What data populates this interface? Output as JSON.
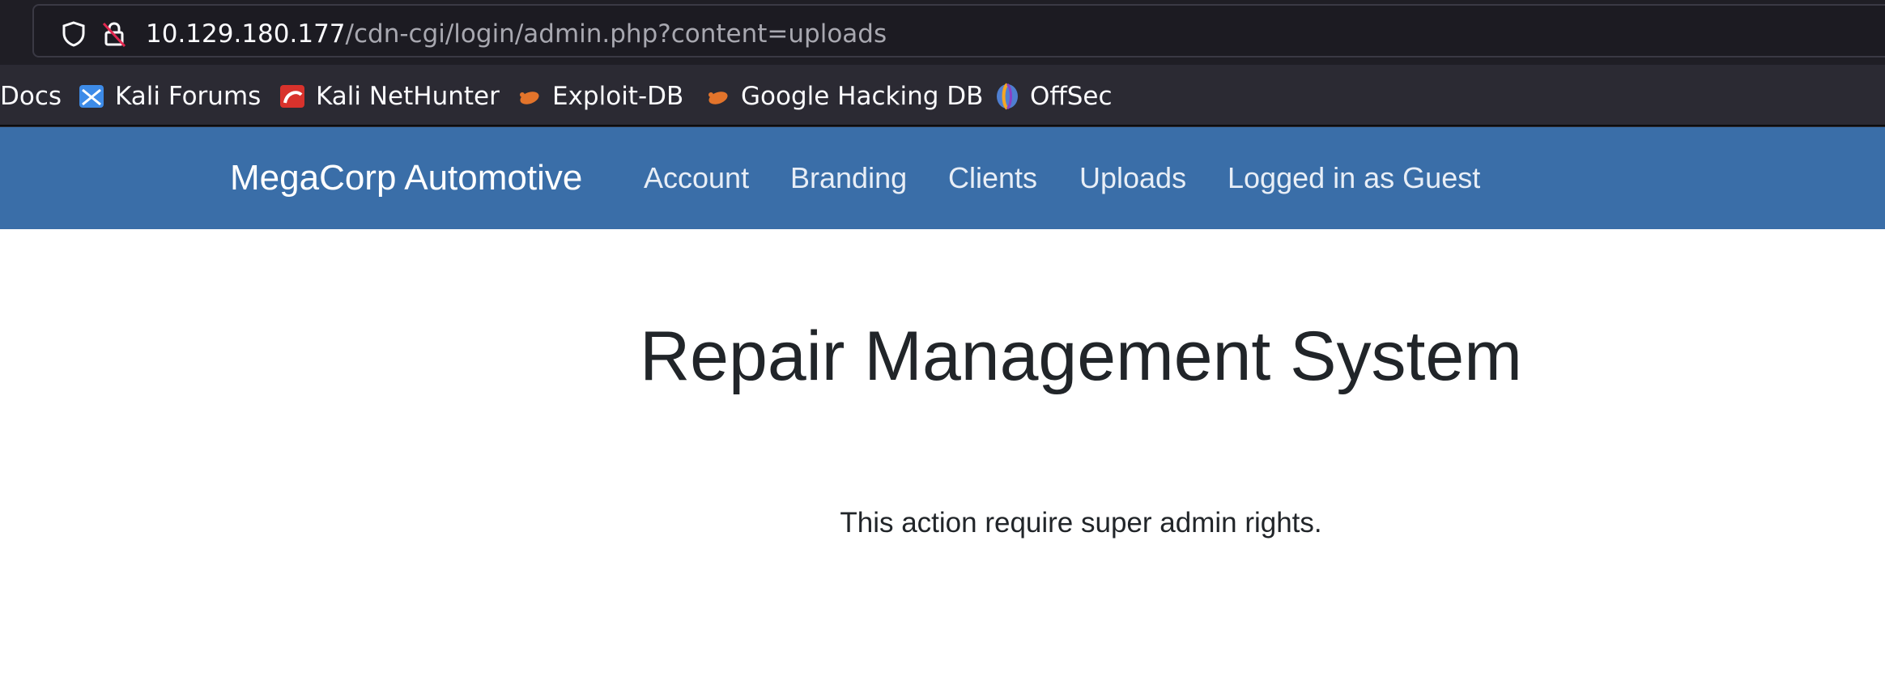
{
  "browser": {
    "url_host": "10.129.180.177",
    "url_path": "/cdn-cgi/login/admin.php?content=uploads",
    "icons": [
      "shield-icon",
      "insecure-lock-icon"
    ],
    "bookmarks": [
      {
        "label": "Docs",
        "icon": ""
      },
      {
        "label": "Kali Forums",
        "icon": "kali-forums-icon"
      },
      {
        "label": "Kali NetHunter",
        "icon": "kali-nethunter-icon"
      },
      {
        "label": "Exploit-DB",
        "icon": "exploit-db-icon"
      },
      {
        "label": "Google Hacking DB",
        "icon": "google-hacking-db-icon"
      },
      {
        "label": "OffSec",
        "icon": "offsec-icon"
      }
    ]
  },
  "navbar": {
    "brand": "MegaCorp Automotive",
    "links": [
      "Account",
      "Branding",
      "Clients",
      "Uploads",
      "Logged in as Guest"
    ],
    "background_color": "#3a6ea8"
  },
  "main": {
    "title": "Repair Management System",
    "message": "This action require super admin rights."
  }
}
